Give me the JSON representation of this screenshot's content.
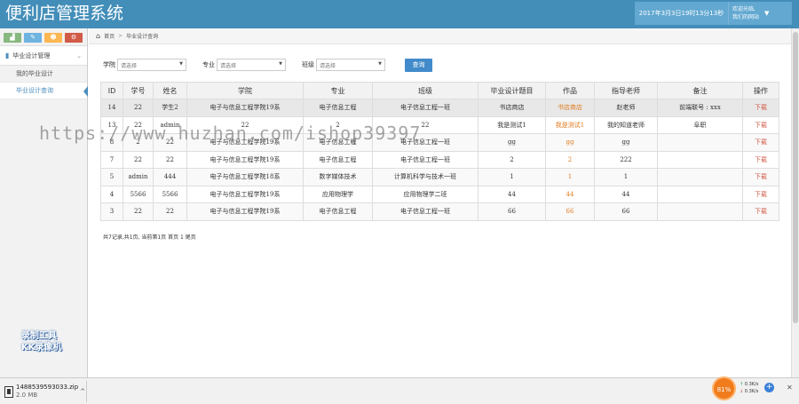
{
  "header": {
    "title": "便利店管理系统",
    "datetime": "2017年3月3日19时13分13秒",
    "user_line1": "欢迎光临,",
    "user_line2": "我们的网站"
  },
  "sidebar": {
    "shortcut_icons": [
      "chart-icon",
      "pencil-icon",
      "users-icon",
      "cogs-icon"
    ],
    "group": "毕业设计管理",
    "items": [
      {
        "label": "我的毕业设计"
      },
      {
        "label": "毕业设计查询"
      }
    ]
  },
  "breadcrumb": {
    "home": "首页",
    "current": "毕业设计查询"
  },
  "filters": {
    "college_label": "学院",
    "major_label": "专业",
    "class_label": "班级",
    "placeholder": "请选择",
    "query_button": "查询"
  },
  "table": {
    "columns": [
      "ID",
      "学号",
      "姓名",
      "学院",
      "专业",
      "班级",
      "毕业设计题目",
      "作品",
      "指导老师",
      "备注",
      "操作"
    ],
    "rows": [
      [
        "14",
        "22",
        "学生2",
        "电子与信息工程学院19系",
        "电子信息工程",
        "电子信息工程一班",
        "书店商店",
        "书店商店",
        "赵老师",
        "前端联号 : xxx",
        "下载"
      ],
      [
        "13",
        "22",
        "admin",
        "22",
        "2",
        "22",
        "我是测试1",
        "我是测试1",
        "我的知道老师",
        "阜职",
        "下载"
      ],
      [
        "8",
        "2",
        "22",
        "电子与信息工程学院19系",
        "电子信息工程",
        "电子信息工程一班",
        "gg",
        "gg",
        "gg",
        "",
        "下载"
      ],
      [
        "7",
        "22",
        "22",
        "电子与信息工程学院19系",
        "电子信息工程",
        "电子信息工程一班",
        "2",
        "2",
        "222",
        "",
        "下载"
      ],
      [
        "5",
        "admin",
        "444",
        "电子与信息工程学院18系",
        "数字媒体技术",
        "计算机科学与技术一班",
        "1",
        "1",
        "1",
        "",
        "下载"
      ],
      [
        "4",
        "5566",
        "5566",
        "电子与信息工程学院19系",
        "应用物理学",
        "应用物理学二班",
        "44",
        "44",
        "44",
        "",
        "下载"
      ],
      [
        "3",
        "22",
        "22",
        "电子与信息工程学院19系",
        "电子信息工程",
        "电子信息工程一班",
        "66",
        "66",
        "66",
        "",
        "下载"
      ]
    ]
  },
  "pager": {
    "summary": "共7记录,共1页, 当前第1页 首页 1 尾页"
  },
  "watermark": "https://www.huzhan.com/ishop39397",
  "recorder_badge": {
    "line1": "录制工具",
    "line2": "KK录像机"
  },
  "download_bar": {
    "file_name": "1488539593033.zip",
    "file_size": "2.0 MB"
  },
  "speed_widget": {
    "cpu": "81%",
    "up": "0.3K/s",
    "down": "0.3K/s"
  },
  "colors": {
    "header": "#438eb9",
    "accent": "#428bca",
    "link_orange": "#e07b1f",
    "download_red": "#d15b47"
  }
}
